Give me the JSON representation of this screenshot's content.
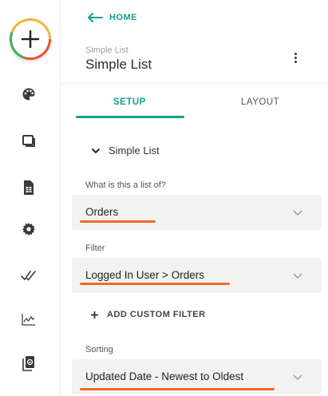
{
  "nav": {
    "home_label": "HOME"
  },
  "header": {
    "subtitle": "Simple List",
    "title": "Simple List"
  },
  "tabs": [
    {
      "label": "SETUP",
      "active": true
    },
    {
      "label": "LAYOUT",
      "active": false
    }
  ],
  "section": {
    "label": "Simple List"
  },
  "fields": {
    "list_of": {
      "label": "What is this a list of?",
      "value": "Orders"
    },
    "filter": {
      "label": "Filter",
      "value": "Logged In User > Orders"
    },
    "sorting": {
      "label": "Sorting",
      "value": "Updated Date - Newest to Oldest"
    }
  },
  "add_filter_label": "ADD CUSTOM FILTER",
  "sidebar_icons": [
    "add-icon",
    "palette-icon",
    "screens-icon",
    "data-sheet-icon",
    "settings-icon",
    "checks-icon",
    "analytics-icon",
    "publish-icon"
  ],
  "colors": {
    "accent": "#12a08e",
    "highlight": "#f06a22"
  }
}
